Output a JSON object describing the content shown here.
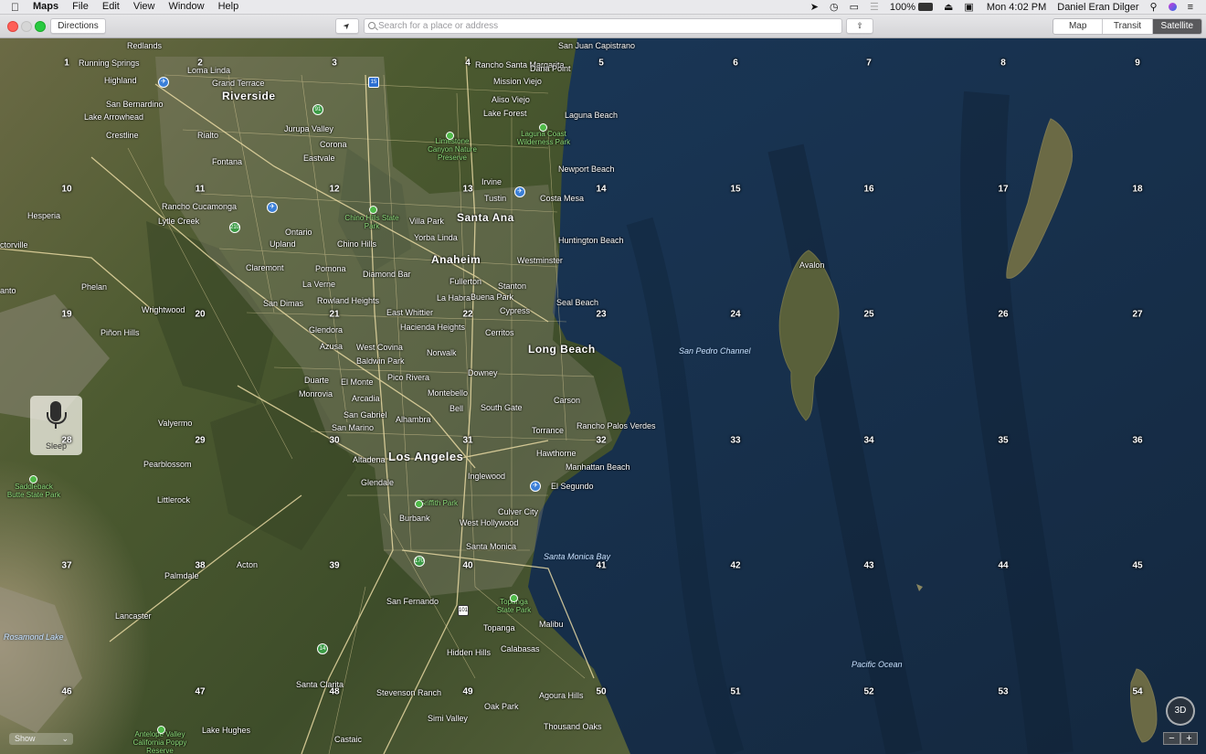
{
  "menubar": {
    "app_name": "Maps",
    "menus": [
      "File",
      "Edit",
      "View",
      "Window",
      "Help"
    ],
    "battery": "100%",
    "clock": "Mon 4:02 PM",
    "user": "Daniel Eran Dilger"
  },
  "toolbar": {
    "directions_label": "Directions",
    "search_placeholder": "Search for a place or address",
    "map_modes": [
      "Map",
      "Transit",
      "Satellite"
    ],
    "active_mode": "Satellite"
  },
  "overlays": {
    "sleep_label": "Sleep",
    "show_label": "Show",
    "threed_label": "3D",
    "zoom_out": "−",
    "zoom_in": "+"
  },
  "grid_numbers": [
    "1",
    "2",
    "3",
    "4",
    "5",
    "6",
    "7",
    "8",
    "9",
    "10",
    "11",
    "12",
    "13",
    "14",
    "15",
    "16",
    "17",
    "18",
    "19",
    "20",
    "21",
    "22",
    "23",
    "24",
    "25",
    "26",
    "27",
    "28",
    "29",
    "30",
    "31",
    "32",
    "33",
    "34",
    "35",
    "36",
    "37",
    "38",
    "39",
    "40",
    "41",
    "42",
    "43",
    "44",
    "45",
    "46",
    "47",
    "48",
    "49",
    "50",
    "51",
    "52",
    "53",
    "54"
  ],
  "labels": {
    "redlands": "Redlands",
    "running_springs": "Running Springs",
    "loma_linda": "Loma Linda",
    "highland": "Highland",
    "grand_terrace": "Grand Terrace",
    "riverside": "Riverside",
    "san_bernardino": "San Bernardino",
    "lake_arrowhead": "Lake Arrowhead",
    "crestline": "Crestline",
    "rialto": "Rialto",
    "fontana": "Fontana",
    "jurupa_valley": "Jurupa Valley",
    "corona": "Corona",
    "eastvale": "Eastvale",
    "rancho_santa_margarita": "Rancho Santa Margarita",
    "dana_point": "Dana Point",
    "san_juan_capistrano": "San Juan Capistrano",
    "mission_viejo": "Mission Viejo",
    "aliso_viejo": "Aliso Viejo",
    "lake_forest": "Lake Forest",
    "laguna_beach": "Laguna Beach",
    "laguna_coast": "Laguna Coast Wilderness Park",
    "limestone": "Limestone Canyon Nature Preserve",
    "newport_beach": "Newport Beach",
    "irvine": "Irvine",
    "tustin": "Tustin",
    "costa_mesa": "Costa Mesa",
    "santa_ana": "Santa Ana",
    "huntington_beach": "Huntington Beach",
    "villa_park": "Villa Park",
    "yorba_linda": "Yorba Linda",
    "anaheim": "Anaheim",
    "fullerton": "Fullerton",
    "westminster": "Westminster",
    "stanton": "Stanton",
    "chino_hills_park": "Chino Hills State Park",
    "chino_hills": "Chino Hills",
    "rancho_cucamonga": "Rancho Cucamonga",
    "lytle_creek": "Lytle Creek",
    "hesperia": "Hesperia",
    "victorville": "ctorville",
    "ontario": "Ontario",
    "upland": "Upland",
    "claremont": "Claremont",
    "pomona": "Pomona",
    "diamond_bar": "Diamond Bar",
    "la_verne": "La Verne",
    "san_dimas": "San Dimas",
    "rowland_heights": "Rowland Heights",
    "la_habra": "La Habra",
    "buena_park": "Buena Park",
    "cypress": "Cypress",
    "seal_beach": "Seal Beach",
    "east_whittier": "East Whittier",
    "hacienda_heights": "Hacienda Heights",
    "glendora": "Glendora",
    "azusa": "Azusa",
    "west_covina": "West Covina",
    "baldwin_park": "Baldwin Park",
    "norwalk": "Norwalk",
    "cerritos": "Cerritos",
    "long_beach": "Long Beach",
    "phelan": "Phelan",
    "wrightwood": "Wrightwood",
    "pinon_hills": "Piñon Hills",
    "santo": "anto",
    "duarte": "Duarte",
    "monrovia": "Monrovia",
    "el_monte": "El Monte",
    "pico_rivera": "Pico Rivera",
    "downey": "Downey",
    "arcadia": "Arcadia",
    "montebello": "Montebello",
    "bell": "Bell",
    "south_gate": "South Gate",
    "carson": "Carson",
    "rancho_palos": "Rancho Palos Verdes",
    "san_gabriel": "San Gabriel",
    "alhambra": "Alhambra",
    "san_marino": "San Marino",
    "altadena": "Altadena",
    "torrance": "Torrance",
    "los_angeles": "Los Angeles",
    "hawthorne": "Hawthorne",
    "manhattan_beach": "Manhattan Beach",
    "el_segundo": "El Segundo",
    "inglewood": "Inglewood",
    "glendale": "Glendale",
    "valyermo": "Valyermo",
    "pearblossom": "Pearblossom",
    "littlerock": "Littlerock",
    "saddleback": "Saddleback Butte State Park",
    "griffith_park": "Griffith Park",
    "burbank": "Burbank",
    "culver_city": "Culver City",
    "west_hollywood": "West Hollywood",
    "santa_monica": "Santa Monica",
    "santa_monica_bay": "Santa Monica Bay",
    "palmdale": "Palmdale",
    "acton": "Acton",
    "lancaster": "Lancaster",
    "rosamond_lake": "Rosamond Lake",
    "san_fernando": "San Fernando",
    "topanga_park": "Topanga State Park",
    "topanga": "Topanga",
    "malibu": "Malibu",
    "calabasas": "Calabasas",
    "hidden_hills": "Hidden Hills",
    "santa_clarita": "Santa Clarita",
    "stevenson_ranch": "Stevenson Ranch",
    "simi_valley": "Simi Valley",
    "agoura_hills": "Agoura Hills",
    "oak_park": "Oak Park",
    "thousand_oaks": "Thousand Oaks",
    "lake_hughes": "Lake Hughes",
    "castaic": "Castaic",
    "antelope": "Antelope Valley California Poppy Reserve",
    "avalon": "Avalon",
    "san_pedro_channel": "San Pedro Channel",
    "pacific_ocean": "Pacific Ocean"
  },
  "shields": {
    "i15": "15",
    "r91": "91",
    "r210": "210",
    "r14": "14",
    "r170": "170",
    "r101": "101"
  },
  "colors": {
    "ocean": "#1c3350",
    "land": "#4e5a33",
    "roads": "#e8d7a1",
    "active_segment": "#59595c"
  }
}
